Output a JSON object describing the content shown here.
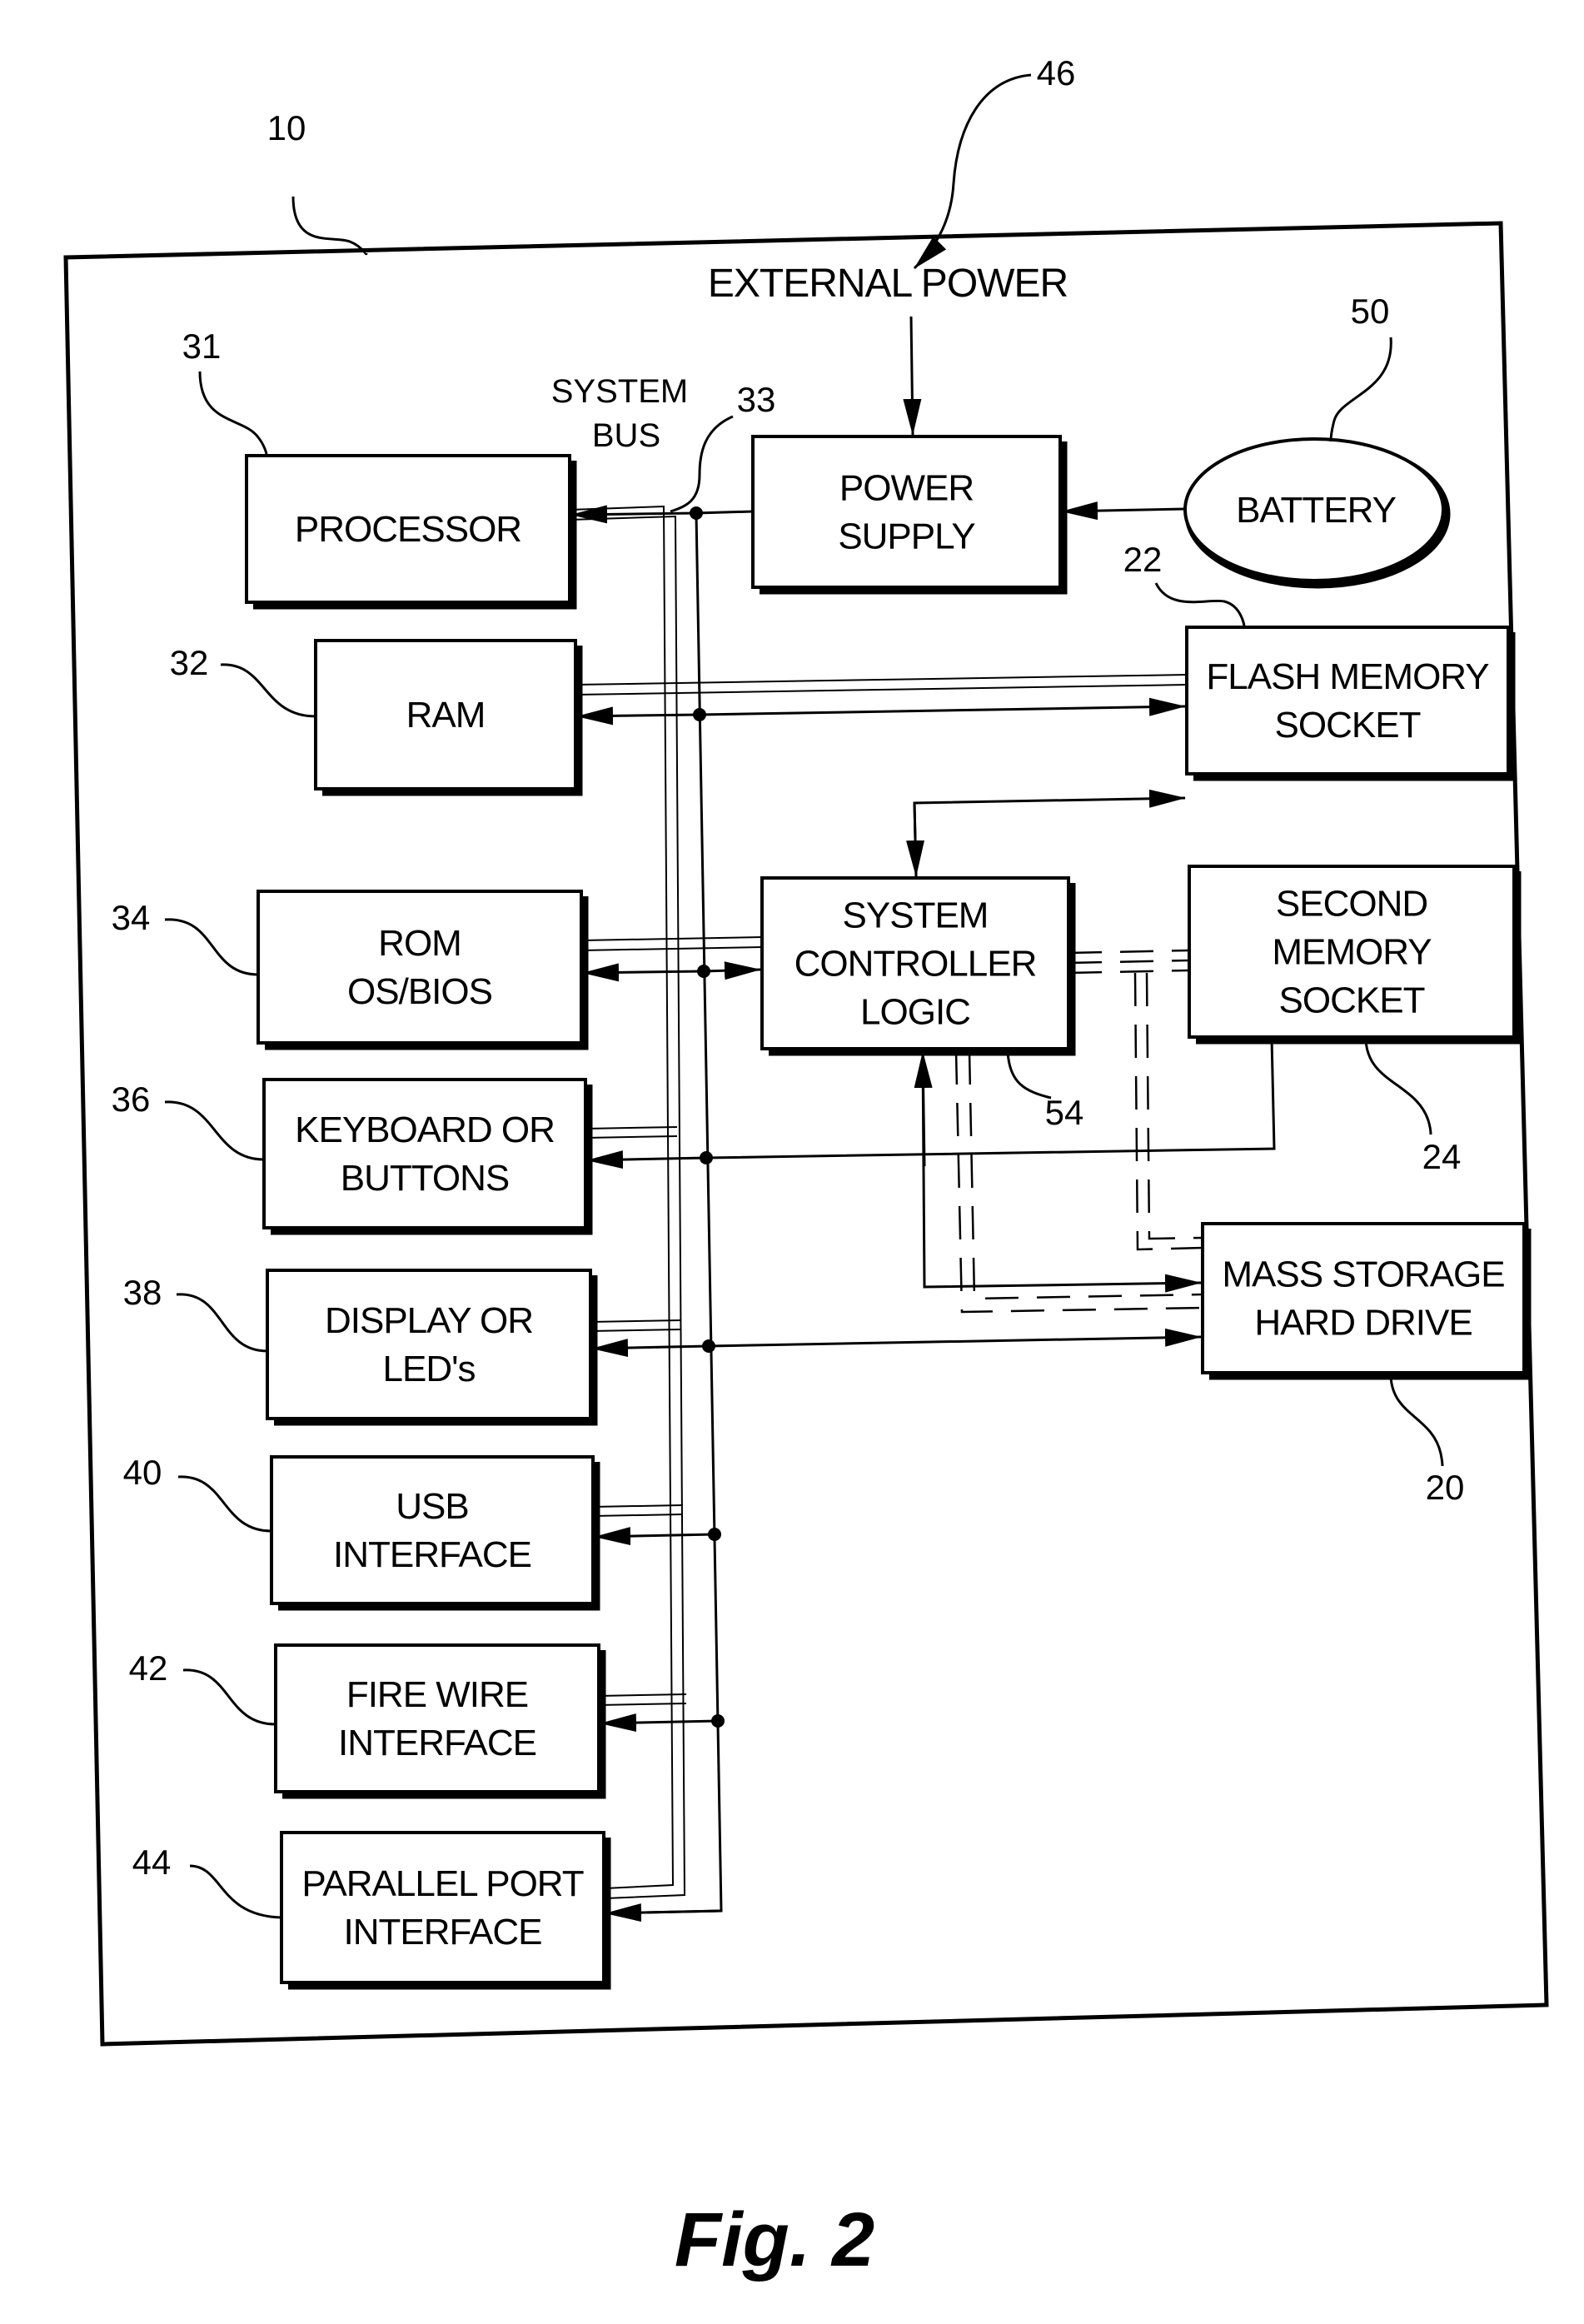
{
  "figure": {
    "caption": "Fig. 2",
    "frame_ref": "10",
    "external_power": {
      "label": "EXTERNAL POWER",
      "ref": "46"
    },
    "system_bus": {
      "label_line1": "SYSTEM",
      "label_line2": "BUS",
      "ref": "33"
    },
    "blocks": {
      "processor": {
        "lines": [
          "PROCESSOR"
        ],
        "ref": "31"
      },
      "ram": {
        "lines": [
          "RAM"
        ],
        "ref": "32"
      },
      "rom": {
        "lines": [
          "ROM",
          "OS/BIOS"
        ],
        "ref": "34"
      },
      "keyboard": {
        "lines": [
          "KEYBOARD OR",
          "BUTTONS"
        ],
        "ref": "36"
      },
      "display": {
        "lines": [
          "DISPLAY  OR",
          "LED's"
        ],
        "ref": "38"
      },
      "usb": {
        "lines": [
          "USB",
          "INTERFACE"
        ],
        "ref": "40"
      },
      "firewire": {
        "lines": [
          "FIRE WIRE",
          "INTERFACE"
        ],
        "ref": "42"
      },
      "parallel": {
        "lines": [
          "PARALLEL PORT",
          "INTERFACE"
        ],
        "ref": "44"
      },
      "power_supply": {
        "lines": [
          "POWER",
          "SUPPLY"
        ]
      },
      "battery": {
        "lines": [
          "BATTERY"
        ],
        "ref": "50"
      },
      "flash": {
        "lines": [
          "FLASH MEMORY",
          "SOCKET"
        ],
        "ref": "22"
      },
      "controller": {
        "lines": [
          "SYSTEM",
          "CONTROLLER",
          "LOGIC"
        ],
        "ref": "54"
      },
      "second_memory": {
        "lines": [
          "SECOND",
          "MEMORY",
          "SOCKET"
        ],
        "ref": "24"
      },
      "mass_storage": {
        "lines": [
          "MASS STORAGE",
          "HARD DRIVE"
        ],
        "ref": "20"
      }
    }
  }
}
